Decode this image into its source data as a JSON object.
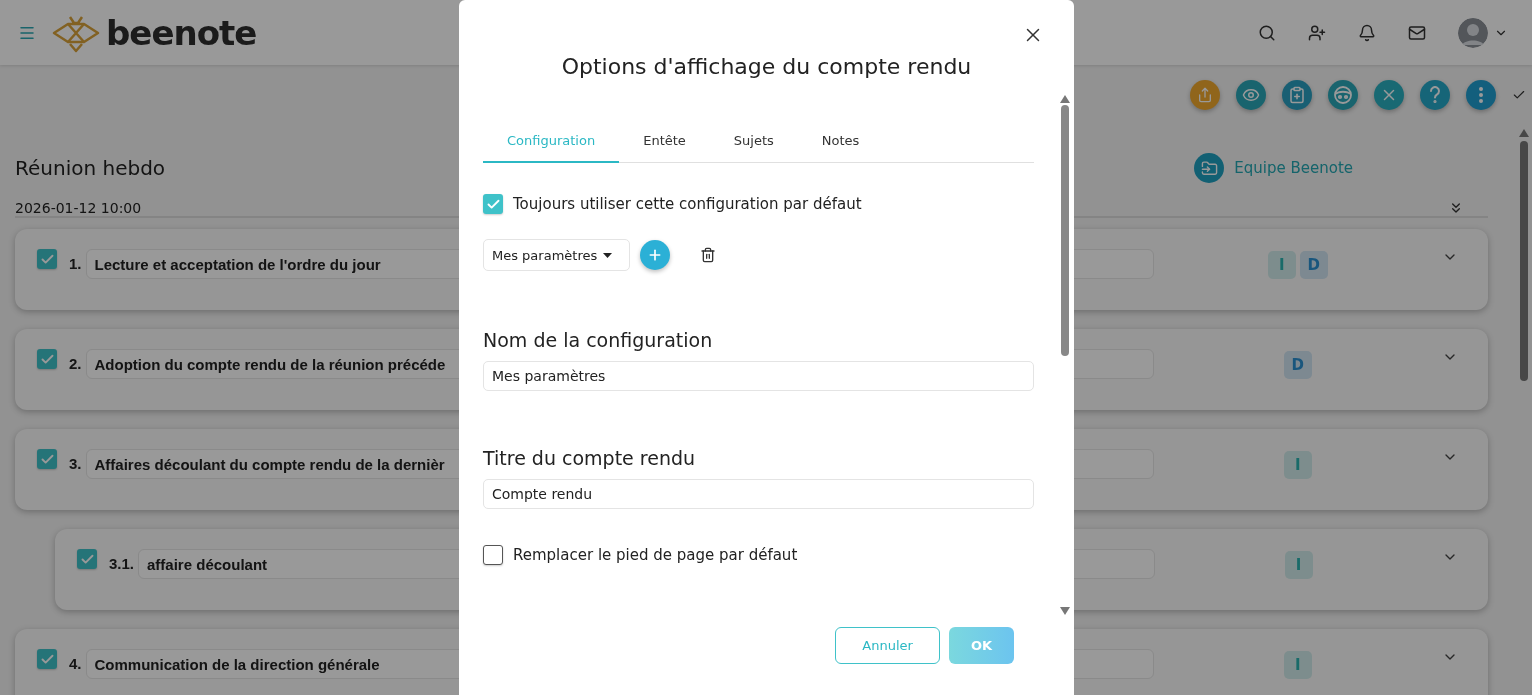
{
  "header": {
    "logo_text": "beenote"
  },
  "toolbar": {
    "buttons": [
      {
        "kind": "share"
      },
      {
        "kind": "eye"
      },
      {
        "kind": "clipboard"
      },
      {
        "kind": "head"
      },
      {
        "kind": "close"
      },
      {
        "kind": "help"
      },
      {
        "kind": "more"
      }
    ]
  },
  "meeting": {
    "title": "Réunion hebdo",
    "date": "2026-01-12 10:00",
    "team": "Equipe Beenote"
  },
  "agenda": {
    "items": [
      {
        "number": "1.",
        "title": "Lecture et acceptation de l'ordre du jour",
        "checked": true,
        "badges": [
          {
            "label": "I",
            "kind": "teal"
          },
          {
            "label": "D",
            "kind": "blue"
          }
        ]
      },
      {
        "number": "2.",
        "title": "Adoption du compte rendu de la réunion précéde",
        "checked": true,
        "badges": [
          {
            "label": "D",
            "kind": "blue"
          }
        ]
      },
      {
        "number": "3.",
        "title": "Affaires découlant du compte rendu de la dernièr",
        "checked": true,
        "badges": [
          {
            "label": "I",
            "kind": "teal"
          }
        ],
        "children": [
          {
            "number": "3.1.",
            "title": "affaire découlant",
            "checked": true,
            "badges": [
              {
                "label": "I",
                "kind": "teal"
              }
            ]
          }
        ]
      },
      {
        "number": "4.",
        "title": "Communication de la direction générale",
        "checked": true,
        "badges": [
          {
            "label": "I",
            "kind": "teal"
          }
        ]
      }
    ]
  },
  "dialog": {
    "title": "Options d'affichage du compte rendu",
    "tabs": [
      {
        "label": "Configuration",
        "selected": true
      },
      {
        "label": "Entête",
        "selected": false
      },
      {
        "label": "Sujets",
        "selected": false
      },
      {
        "label": "Notes",
        "selected": false
      }
    ],
    "default_checkbox": {
      "label": "Toujours utiliser cette configuration par défaut",
      "checked": true
    },
    "preset_select": {
      "value": "Mes paramètres"
    },
    "fields": [
      {
        "label": "Nom de la configuration",
        "value": "Mes paramètres"
      },
      {
        "label": "Titre du compte rendu",
        "value": "Compte rendu"
      }
    ],
    "footer_checkbox": {
      "label": "Remplacer le pied de page par défaut",
      "checked": false
    },
    "buttons": [
      {
        "label": "Annuler",
        "kind": "secondary"
      },
      {
        "label": "OK",
        "kind": "primary"
      }
    ]
  }
}
